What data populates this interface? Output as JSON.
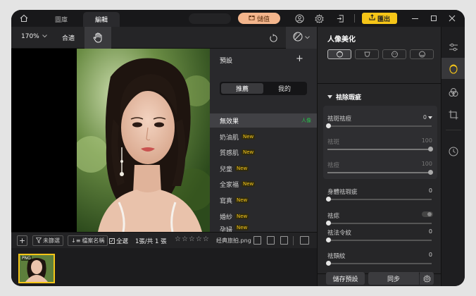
{
  "titlebar": {
    "tabs": [
      {
        "label": "圖庫"
      },
      {
        "label": "編輯"
      }
    ],
    "vip_label": "儲值",
    "export_label": "匯出"
  },
  "toolbar": {
    "zoom": "170%",
    "fit_label": "合適"
  },
  "presets": {
    "title": "預設",
    "segments": [
      "推薦",
      "我的"
    ],
    "items": [
      {
        "label": "無效果",
        "badge": "人像"
      },
      {
        "label": "奶油肌",
        "badge": "New"
      },
      {
        "label": "質感肌",
        "badge": "New"
      },
      {
        "label": "兒童",
        "badge": "New"
      },
      {
        "label": "全家福",
        "badge": "New"
      },
      {
        "label": "寫真",
        "badge": "New"
      },
      {
        "label": "婚紗",
        "badge": "New"
      },
      {
        "label": "孕婦",
        "badge": "New"
      }
    ]
  },
  "bottombar": {
    "unfiltered": "未篩選",
    "sort": "檔案名稱",
    "select_all": "全選",
    "count": "1張/共 1 張",
    "stars": "☆☆☆☆☆",
    "filename": "经典旅拍.png"
  },
  "filmstrip": {
    "thumb_tag": "PNG"
  },
  "right_panel": {
    "title": "人像美化",
    "section_title": "祛除瑕疵",
    "sliders": [
      {
        "label": "祛斑祛痘",
        "value": "0",
        "pct": 0
      },
      {
        "label": "祛斑",
        "value": "100",
        "pct": 100
      },
      {
        "label": "祛痘",
        "value": "100",
        "pct": 100
      },
      {
        "label": "身體祛瑕疵",
        "value": "0",
        "pct": 0
      },
      {
        "label": "祛痣",
        "value": "",
        "pct": 0
      },
      {
        "label": "祛法令紋",
        "value": "0",
        "pct": 0
      },
      {
        "label": "祛頸紋",
        "value": "0",
        "pct": 0
      }
    ],
    "save_preset": "儲存預設",
    "sync": "同步"
  },
  "colors": {
    "accent": "#f5c518",
    "vip": "#f3b58c",
    "panel": "#262628"
  }
}
